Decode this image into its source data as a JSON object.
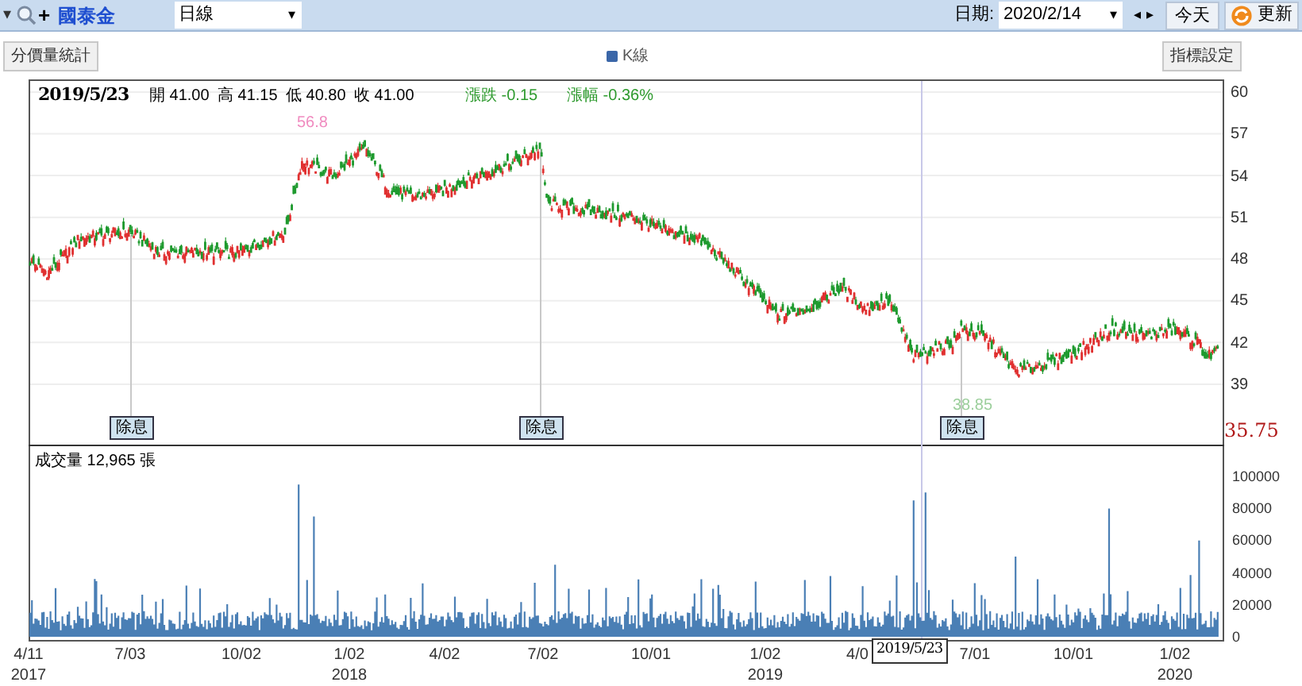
{
  "toolbar": {
    "dropdown_caret": "▾",
    "zoom_plus": "+",
    "stock_name": "國泰金",
    "period": {
      "value": "日線",
      "caret": "▾"
    },
    "date_label": "日期:",
    "date": {
      "value": "2020/2/14",
      "caret": "▾"
    },
    "prev": "◂",
    "next": "▸",
    "today_button": "今天",
    "refresh_button": "更新"
  },
  "subbar": {
    "left_button": "分價量統計",
    "legend": "K線",
    "right_button": "指標設定"
  },
  "quote": {
    "date": "2019/5/23",
    "items": [
      {
        "text": "開 41.00",
        "kind": "price"
      },
      {
        "text": "高 41.15",
        "kind": "price"
      },
      {
        "text": "低 40.80",
        "kind": "price"
      },
      {
        "text": "收 41.00",
        "kind": "price"
      },
      {
        "text": "漲跌 -0.15",
        "kind": "change"
      },
      {
        "text": "漲幅 -0.36%",
        "kind": "change"
      }
    ]
  },
  "price_axis": [
    "60",
    "57",
    "54",
    "51",
    "48",
    "45",
    "42",
    "39"
  ],
  "last_price": "35.75",
  "high_label": "56.8",
  "low_label": "38.85",
  "dividend_markers": [
    "除息",
    "除息",
    "除息"
  ],
  "volume_title": "成交量 12,965 張",
  "volume_axis": [
    "100000",
    "80000",
    "60000",
    "40000",
    "20000",
    "0"
  ],
  "x_axis": [
    {
      "label": "4/11",
      "year": "2017"
    },
    {
      "label": "7/03"
    },
    {
      "label": "10/02"
    },
    {
      "label": "1/02",
      "year": "2018"
    },
    {
      "label": "4/02"
    },
    {
      "label": "7/02"
    },
    {
      "label": "10/01"
    },
    {
      "label": "1/02",
      "year": "2019"
    },
    {
      "label": "4/0"
    },
    {
      "label": "7/01"
    },
    {
      "label": "10/01"
    },
    {
      "label": "1/02",
      "year": "2020"
    }
  ],
  "crosshair_date": "2019/5/23"
}
